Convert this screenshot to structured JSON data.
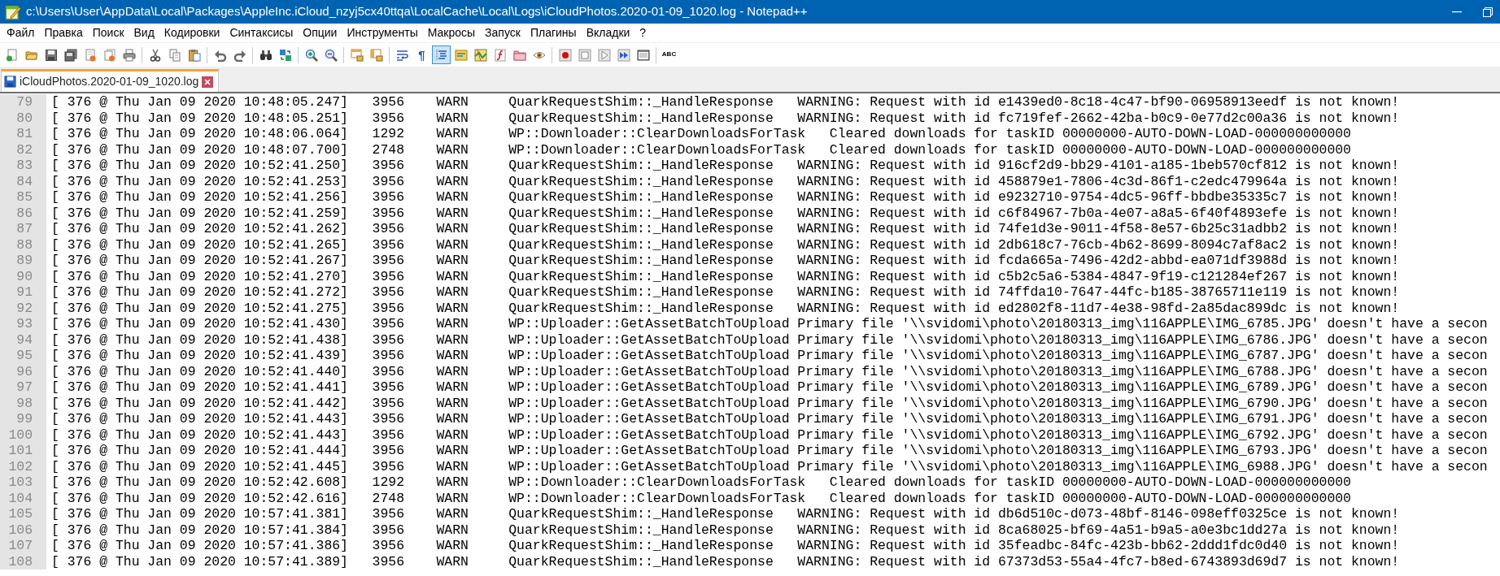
{
  "window": {
    "title": "c:\\Users\\User\\AppData\\Local\\Packages\\AppleInc.iCloud_nzyj5cx40ttqa\\LocalCache\\Local\\Logs\\iCloudPhotos.2020-01-09_1020.log - Notepad++"
  },
  "menu": [
    "Файл",
    "Правка",
    "Поиск",
    "Вид",
    "Кодировки",
    "Синтаксисы",
    "Опции",
    "Инструменты",
    "Макросы",
    "Запуск",
    "Плагины",
    "Вкладки",
    "?"
  ],
  "toolbar": [
    {
      "buttons": [
        {
          "pressed": false
        },
        {
          "pressed": false
        },
        {
          "pressed": false
        },
        {
          "pressed": false
        },
        {
          "pressed": false
        },
        {
          "pressed": false
        },
        {
          "pressed": false
        }
      ]
    },
    {
      "buttons": [
        {
          "pressed": false
        },
        {
          "pressed": false
        },
        {
          "pressed": false
        }
      ]
    },
    {
      "buttons": [
        {
          "pressed": false
        },
        {
          "pressed": false
        }
      ]
    },
    {
      "buttons": [
        {
          "pressed": false
        },
        {
          "pressed": false
        }
      ]
    },
    {
      "buttons": [
        {
          "pressed": false
        },
        {
          "pressed": false
        }
      ]
    },
    {
      "buttons": [
        {
          "pressed": false
        },
        {
          "pressed": false
        }
      ]
    },
    {
      "buttons": [
        {
          "pressed": false
        },
        {
          "pressed": false,
          "label": "¶"
        },
        {
          "pressed": true
        },
        {
          "pressed": false
        },
        {
          "pressed": false
        },
        {
          "pressed": false
        },
        {
          "pressed": false
        },
        {
          "pressed": false
        }
      ]
    },
    {
      "buttons": [
        {
          "pressed": false
        },
        {
          "pressed": false
        },
        {
          "pressed": false
        },
        {
          "pressed": false
        },
        {
          "pressed": false
        }
      ]
    },
    {
      "buttons": [
        {
          "pressed": false,
          "label": "ABC"
        }
      ]
    }
  ],
  "tabs": [
    {
      "label": "iCloudPhotos.2020-01-09_1020.log",
      "selected": true
    }
  ],
  "lines": [
    {
      "number": "79",
      "text": "[ 376 @ Thu Jan 09 2020 10:48:05.247]   3956    WARN     QuarkRequestShim::_HandleResponse   WARNING: Request with id e1439ed0-8c18-4c47-bf90-06958913eedf is not known!"
    },
    {
      "number": "80",
      "text": "[ 376 @ Thu Jan 09 2020 10:48:05.251]   3956    WARN     QuarkRequestShim::_HandleResponse   WARNING: Request with id fc719fef-2662-42ba-b0c9-0e77d2c00a36 is not known!"
    },
    {
      "number": "81",
      "text": "[ 376 @ Thu Jan 09 2020 10:48:06.064]   1292    WARN     WP::Downloader::ClearDownloadsForTask   Cleared downloads for taskID 00000000-AUTO-DOWN-LOAD-000000000000"
    },
    {
      "number": "82",
      "text": "[ 376 @ Thu Jan 09 2020 10:48:07.700]   2748    WARN     WP::Downloader::ClearDownloadsForTask   Cleared downloads for taskID 00000000-AUTO-DOWN-LOAD-000000000000"
    },
    {
      "number": "83",
      "text": "[ 376 @ Thu Jan 09 2020 10:52:41.250]   3956    WARN     QuarkRequestShim::_HandleResponse   WARNING: Request with id 916cf2d9-bb29-4101-a185-1beb570cf812 is not known!"
    },
    {
      "number": "84",
      "text": "[ 376 @ Thu Jan 09 2020 10:52:41.253]   3956    WARN     QuarkRequestShim::_HandleResponse   WARNING: Request with id 458879e1-7806-4c3d-86f1-c2edc479964a is not known!"
    },
    {
      "number": "85",
      "text": "[ 376 @ Thu Jan 09 2020 10:52:41.256]   3956    WARN     QuarkRequestShim::_HandleResponse   WARNING: Request with id e9232710-9754-4dc5-96ff-bbdbe35335c7 is not known!"
    },
    {
      "number": "86",
      "text": "[ 376 @ Thu Jan 09 2020 10:52:41.259]   3956    WARN     QuarkRequestShim::_HandleResponse   WARNING: Request with id c6f84967-7b0a-4e07-a8a5-6f40f4893efe is not known!"
    },
    {
      "number": "87",
      "text": "[ 376 @ Thu Jan 09 2020 10:52:41.262]   3956    WARN     QuarkRequestShim::_HandleResponse   WARNING: Request with id 74fe1d3e-9011-4f58-8e57-6b25c31adbb2 is not known!"
    },
    {
      "number": "88",
      "text": "[ 376 @ Thu Jan 09 2020 10:52:41.265]   3956    WARN     QuarkRequestShim::_HandleResponse   WARNING: Request with id 2db618c7-76cb-4b62-8699-8094c7af8ac2 is not known!"
    },
    {
      "number": "89",
      "text": "[ 376 @ Thu Jan 09 2020 10:52:41.267]   3956    WARN     QuarkRequestShim::_HandleResponse   WARNING: Request with id fcda665a-7496-42d2-abbd-ea071df3988d is not known!"
    },
    {
      "number": "90",
      "text": "[ 376 @ Thu Jan 09 2020 10:52:41.270]   3956    WARN     QuarkRequestShim::_HandleResponse   WARNING: Request with id c5b2c5a6-5384-4847-9f19-c121284ef267 is not known!"
    },
    {
      "number": "91",
      "text": "[ 376 @ Thu Jan 09 2020 10:52:41.272]   3956    WARN     QuarkRequestShim::_HandleResponse   WARNING: Request with id 74ffda10-7647-44fc-b185-38765711e119 is not known!"
    },
    {
      "number": "92",
      "text": "[ 376 @ Thu Jan 09 2020 10:52:41.275]   3956    WARN     QuarkRequestShim::_HandleResponse   WARNING: Request with id ed2802f8-11d7-4e38-98fd-2a85dac899dc is not known!"
    },
    {
      "number": "93",
      "text": "[ 376 @ Thu Jan 09 2020 10:52:41.430]   3956    WARN     WP::Uploader::GetAssetBatchToUpload Primary file '\\\\svidomi\\photo\\20180313_img\\116APPLE\\IMG_6785.JPG' doesn't have a secon"
    },
    {
      "number": "94",
      "text": "[ 376 @ Thu Jan 09 2020 10:52:41.438]   3956    WARN     WP::Uploader::GetAssetBatchToUpload Primary file '\\\\svidomi\\photo\\20180313_img\\116APPLE\\IMG_6786.JPG' doesn't have a secon"
    },
    {
      "number": "95",
      "text": "[ 376 @ Thu Jan 09 2020 10:52:41.439]   3956    WARN     WP::Uploader::GetAssetBatchToUpload Primary file '\\\\svidomi\\photo\\20180313_img\\116APPLE\\IMG_6787.JPG' doesn't have a secon"
    },
    {
      "number": "96",
      "text": "[ 376 @ Thu Jan 09 2020 10:52:41.440]   3956    WARN     WP::Uploader::GetAssetBatchToUpload Primary file '\\\\svidomi\\photo\\20180313_img\\116APPLE\\IMG_6788.JPG' doesn't have a secon"
    },
    {
      "number": "97",
      "text": "[ 376 @ Thu Jan 09 2020 10:52:41.441]   3956    WARN     WP::Uploader::GetAssetBatchToUpload Primary file '\\\\svidomi\\photo\\20180313_img\\116APPLE\\IMG_6789.JPG' doesn't have a secon"
    },
    {
      "number": "98",
      "text": "[ 376 @ Thu Jan 09 2020 10:52:41.442]   3956    WARN     WP::Uploader::GetAssetBatchToUpload Primary file '\\\\svidomi\\photo\\20180313_img\\116APPLE\\IMG_6790.JPG' doesn't have a secon"
    },
    {
      "number": "99",
      "text": "[ 376 @ Thu Jan 09 2020 10:52:41.443]   3956    WARN     WP::Uploader::GetAssetBatchToUpload Primary file '\\\\svidomi\\photo\\20180313_img\\116APPLE\\IMG_6791.JPG' doesn't have a secon"
    },
    {
      "number": "100",
      "text": "[ 376 @ Thu Jan 09 2020 10:52:41.443]   3956    WARN     WP::Uploader::GetAssetBatchToUpload Primary file '\\\\svidomi\\photo\\20180313_img\\116APPLE\\IMG_6792.JPG' doesn't have a secon"
    },
    {
      "number": "101",
      "text": "[ 376 @ Thu Jan 09 2020 10:52:41.444]   3956    WARN     WP::Uploader::GetAssetBatchToUpload Primary file '\\\\svidomi\\photo\\20180313_img\\116APPLE\\IMG_6793.JPG' doesn't have a secon"
    },
    {
      "number": "102",
      "text": "[ 376 @ Thu Jan 09 2020 10:52:41.445]   3956    WARN     WP::Uploader::GetAssetBatchToUpload Primary file '\\\\svidomi\\photo\\20180313_img\\116APPLE\\IMG_6988.JPG' doesn't have a secon"
    },
    {
      "number": "103",
      "text": "[ 376 @ Thu Jan 09 2020 10:52:42.608]   1292    WARN     WP::Downloader::ClearDownloadsForTask   Cleared downloads for taskID 00000000-AUTO-DOWN-LOAD-000000000000"
    },
    {
      "number": "104",
      "text": "[ 376 @ Thu Jan 09 2020 10:52:42.616]   2748    WARN     WP::Downloader::ClearDownloadsForTask   Cleared downloads for taskID 00000000-AUTO-DOWN-LOAD-000000000000"
    },
    {
      "number": "105",
      "text": "[ 376 @ Thu Jan 09 2020 10:57:41.381]   3956    WARN     QuarkRequestShim::_HandleResponse   WARNING: Request with id db6d510c-d073-48bf-8146-098eff0325ce is not known!"
    },
    {
      "number": "106",
      "text": "[ 376 @ Thu Jan 09 2020 10:57:41.384]   3956    WARN     QuarkRequestShim::_HandleResponse   WARNING: Request with id 8ca68025-bf69-4a51-b9a5-a0e3bc1dd27a is not known!"
    },
    {
      "number": "107",
      "text": "[ 376 @ Thu Jan 09 2020 10:57:41.386]   3956    WARN     QuarkRequestShim::_HandleResponse   WARNING: Request with id 35feadbc-84fc-423b-bb62-2ddd1fdc0d40 is not known!"
    },
    {
      "number": "108",
      "text": "[ 376 @ Thu Jan 09 2020 10:57:41.389]   3956    WARN     QuarkRequestShim::_HandleResponse   WARNING: Request with id 67373d53-55a4-4fc7-b8ed-6743893d69d7 is not known!"
    }
  ]
}
